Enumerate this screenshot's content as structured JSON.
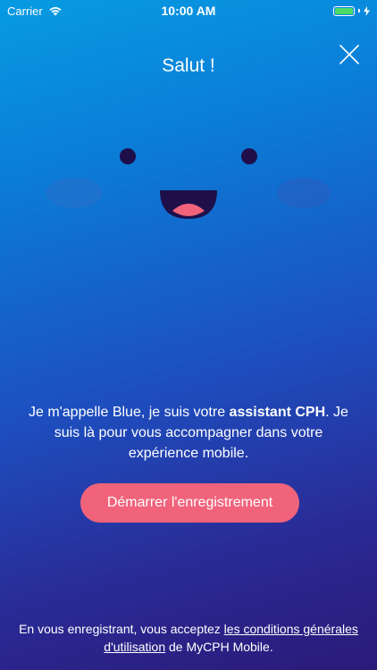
{
  "status_bar": {
    "carrier": "Carrier",
    "time": "10:00 AM",
    "wifi_icon": "wifi-icon",
    "battery_icon": "battery-icon",
    "charging_icon": "bolt-icon"
  },
  "close_icon": "close-icon",
  "title": "Salut !",
  "mascot_icon": "smiling-face-icon",
  "intro": {
    "part1": "Je m'appelle Blue, je suis votre ",
    "bold": "assistant CPH",
    "part2": ". Je suis là pour vous accompagner dans votre expérience mobile."
  },
  "cta_label": "Démarrer l'enregistrement",
  "terms": {
    "prefix": "En vous enregistrant, vous acceptez ",
    "link": "les conditions générales d'utilisation",
    "suffix": " de MyCPH Mobile."
  },
  "colors": {
    "gradient_top": "#079be2",
    "gradient_bottom": "#2b1a78",
    "cta": "#f0637a",
    "mouth": "#1e0f4a",
    "tongue": "#f0637a"
  }
}
